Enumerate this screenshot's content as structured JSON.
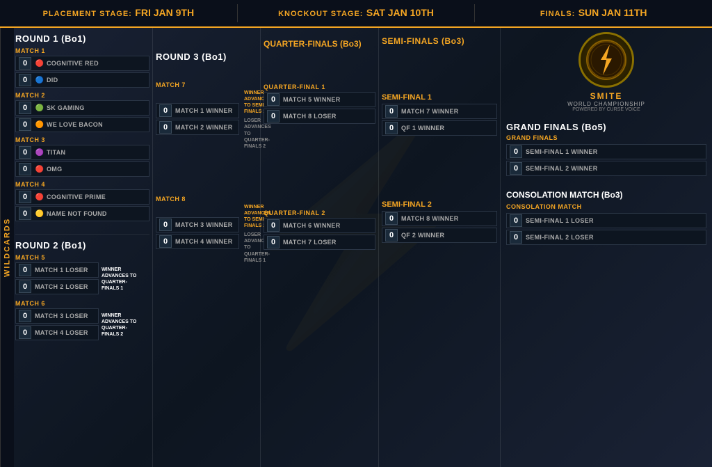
{
  "header": {
    "placement": {
      "label": "PLACEMENT STAGE:",
      "date": "FRI JAN 9TH"
    },
    "knockout": {
      "label": "KNOCKOUT STAGE:",
      "date": "SAT JAN 10TH"
    },
    "finals": {
      "label": "FINALS:",
      "date": "SUN JAN 11TH"
    }
  },
  "wildcards_label": "WILDCARDS",
  "round1": {
    "title": "ROUND 1 (Bo1)",
    "match1": {
      "label": "MATCH 1",
      "team1": {
        "score": "0",
        "name": "COGNITIVE RED",
        "icon": "🔴"
      },
      "team2": {
        "score": "0",
        "name": "DID",
        "icon": "🔵"
      }
    },
    "match2": {
      "label": "MATCH 2",
      "team1": {
        "score": "0",
        "name": "SK GAMING",
        "icon": "🟢"
      },
      "team2": {
        "score": "0",
        "name": "WE LOVE BACON",
        "icon": "🟠"
      }
    },
    "match3": {
      "label": "MATCH 3",
      "team1": {
        "score": "0",
        "name": "TITAN",
        "icon": "🟣"
      },
      "team2": {
        "score": "0",
        "name": "OMG",
        "icon": "🔴"
      }
    },
    "match4": {
      "label": "MATCH 4",
      "team1": {
        "score": "0",
        "name": "COGNITIVE PRIME",
        "icon": "🔴"
      },
      "team2": {
        "score": "0",
        "name": "NAME NOT FOUND",
        "icon": "🟡"
      }
    }
  },
  "round2": {
    "title": "ROUND 2 (Bo1)",
    "match5": {
      "label": "MATCH 5",
      "team1": {
        "score": "0",
        "name": "MATCH 1 LOSER"
      },
      "team2": {
        "score": "0",
        "name": "MATCH 2 LOSER"
      },
      "advance": "WINNER ADVANCES TO QUARTER-FINALS 1"
    },
    "match6": {
      "label": "MATCH 6",
      "team1": {
        "score": "0",
        "name": "MATCH 3 LOSER"
      },
      "team2": {
        "score": "0",
        "name": "MATCH 4 LOSER"
      },
      "advance": "WINNER ADVANCES TO QUARTER-FINALS 2"
    }
  },
  "round3": {
    "title": "ROUND 3 (Bo1)",
    "match7": {
      "label": "MATCH 7",
      "team1": {
        "score": "0",
        "name": "MATCH 1 WINNER"
      },
      "team2": {
        "score": "0",
        "name": "MATCH 2 WINNER"
      },
      "winner_advance": "WINNER ADVANCES TO SEMI-FINALS 1",
      "loser_advance": "LOSER ADVANCES TO QUARTER-FINALS 2"
    },
    "match8": {
      "label": "MATCH 8",
      "team1": {
        "score": "0",
        "name": "MATCH 3 WINNER"
      },
      "team2": {
        "score": "0",
        "name": "MATCH 4 WINNER"
      },
      "winner_advance": "WINNER ADVANCES TO SEMI-FINALS 2",
      "loser_advance": "LOSER ADVANCES TO QUARTER-FINALS 1"
    }
  },
  "quarterfinals": {
    "title": "QUARTER-FINALS (Bo3)",
    "qf1": {
      "label": "QUARTER-FINAL 1",
      "team1": {
        "score": "0",
        "name": "MATCH 5 WINNER"
      },
      "team2": {
        "score": "0",
        "name": "MATCH 8 LOSER"
      }
    },
    "qf2": {
      "label": "QUARTER-FINAL 2",
      "team1": {
        "score": "0",
        "name": "MATCH 6 WINNER"
      },
      "team2": {
        "score": "0",
        "name": "MATCH 7 LOSER"
      }
    }
  },
  "semifinals": {
    "title": "SEMI-FINALS (Bo3)",
    "sf1": {
      "label": "SEMI-FINAL 1",
      "team1": {
        "score": "0",
        "name": "MATCH 7 WINNER"
      },
      "team2": {
        "score": "0",
        "name": "QF 1 WINNER"
      }
    },
    "sf2": {
      "label": "SEMI-FINAL 2",
      "team1": {
        "score": "0",
        "name": "MATCH 8 WINNER"
      },
      "team2": {
        "score": "0",
        "name": "QF 2 WINNER"
      }
    }
  },
  "grandfinals": {
    "title": "GRAND FINALS (Bo5)",
    "section_label": "GRAND FINALS",
    "team1": {
      "score": "0",
      "name": "SEMI-FINAL 1 WINNER"
    },
    "team2": {
      "score": "0",
      "name": "SEMI-FINAL 2 WINNER"
    },
    "consolation_title": "CONSOLATION MATCH (Bo3)",
    "consolation_label": "CONSOLATION MATCH",
    "consolation_team1": {
      "score": "0",
      "name": "SEMI-FINAL 1 LOSER"
    },
    "consolation_team2": {
      "score": "0",
      "name": "SEMI-FINAL 2 LOSER"
    }
  },
  "smite_logo": {
    "text": "⚡",
    "title": "SMITE",
    "subtitle": "WORLD CHAMPIONSHIP",
    "powered_by": "POWERED BY CURSE VOICE"
  },
  "colors": {
    "gold": "#f5a623",
    "dark_bg": "#0d1520",
    "border": "#2a3545"
  }
}
